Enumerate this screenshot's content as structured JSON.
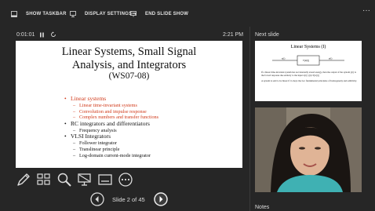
{
  "toolbar": {
    "show_taskbar": "SHOW TASKBAR",
    "display_settings": "DISPLAY SETTINGS",
    "end_slide_show": "END SLIDE SHOW",
    "more": "···"
  },
  "timer": {
    "elapsed": "0:01:01",
    "clock": "2:21 PM"
  },
  "slide": {
    "title_line1": "Linear Systems, Small Signal",
    "title_line2": "Analysis, and Integrators",
    "subtitle": "(WS07-08)",
    "bullets": [
      {
        "text": "Linear systems",
        "highlight": true,
        "subs": [
          {
            "text": "Linear time-invariant systems",
            "highlight": true
          },
          {
            "text": "Convolution and impulse response",
            "highlight": true
          },
          {
            "text": "Complex numbers and transfer functions",
            "highlight": true
          }
        ]
      },
      {
        "text": "RC integrators and differentiators",
        "highlight": false,
        "subs": [
          {
            "text": "Frequency analysis",
            "highlight": false
          }
        ]
      },
      {
        "text": "VLSI Integrators",
        "highlight": false,
        "subs": [
          {
            "text": "Follower integrator",
            "highlight": false
          },
          {
            "text": "Translinear principle",
            "highlight": false
          },
          {
            "text": "Log-domain current-mode integrator",
            "highlight": false
          }
        ]
      }
    ]
  },
  "nav": {
    "slide_counter": "Slide 2 of 45"
  },
  "next_slide": {
    "label": "Next slide",
    "title": "Linear Systems (I)",
    "block_in": "x(t)",
    "block_label": "T[x(t)]",
    "block_out": "y(t)",
    "para1": "If a linear time-invariant system has not internally stored energy, then the output of the system y(t) is the forced response due entirely to the input x(t): y(t)=T[x(t)]",
    "para2": "A system is said to be linear if it obeys the two fundamental principles of homogeneity and additivity."
  },
  "notes": {
    "label": "Notes"
  },
  "colors": {
    "accent_red": "#d13a1a",
    "background": "#262626"
  }
}
